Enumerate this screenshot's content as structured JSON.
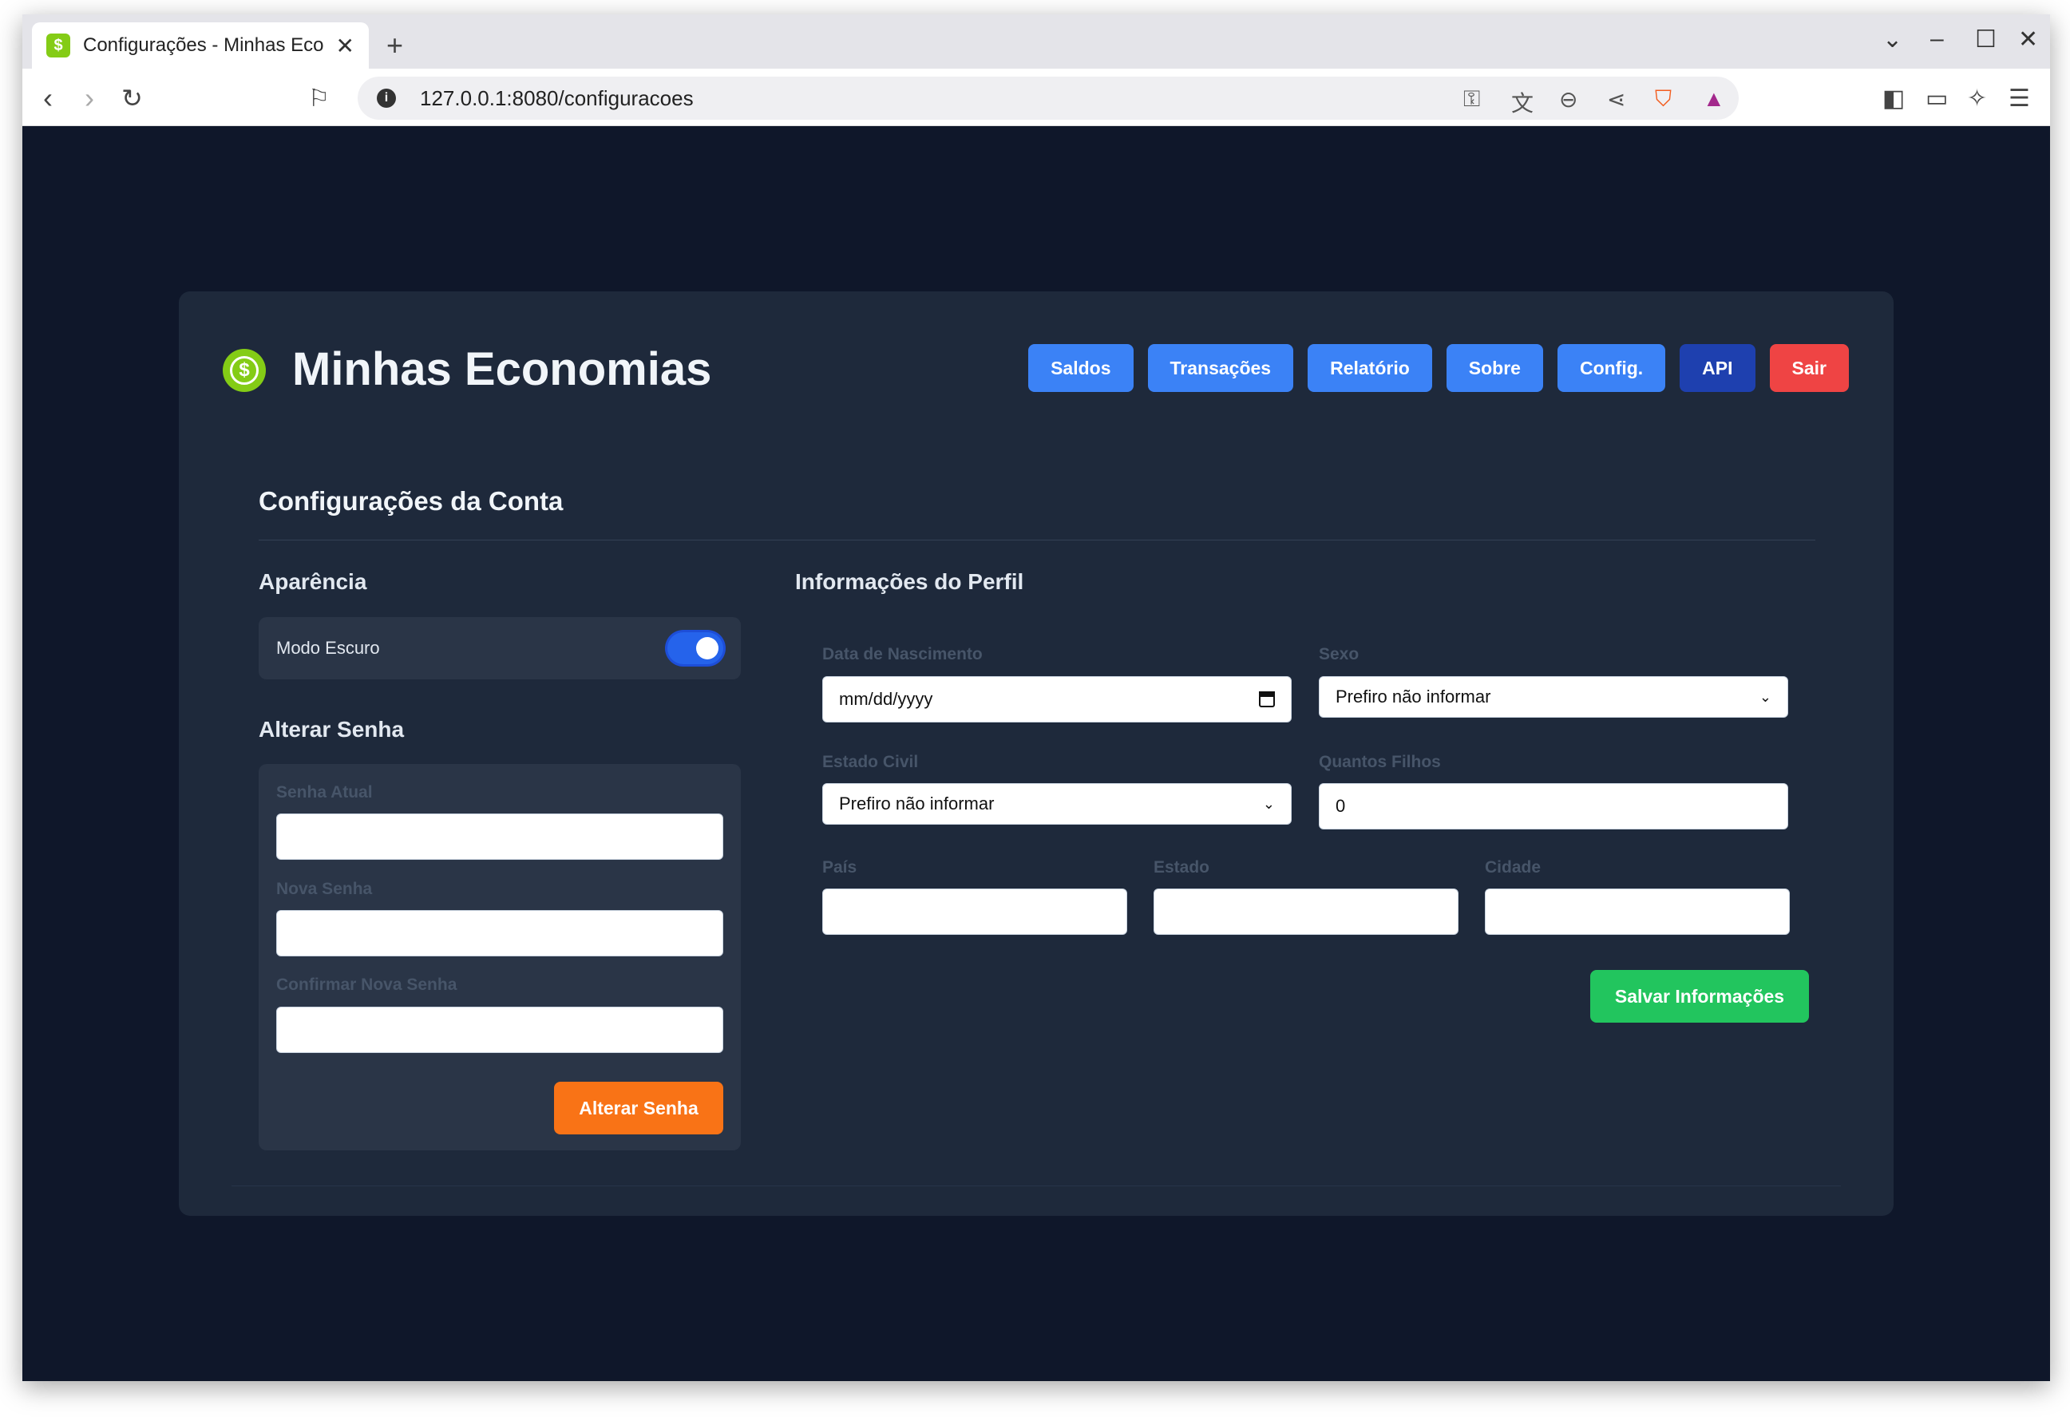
{
  "browser": {
    "tab_title": "Configurações - Minhas Ecor",
    "favicon": "$",
    "url": "127.0.0.1:8080/configuracoes"
  },
  "app": {
    "brand_title": "Minhas Economias",
    "brand_icon": "$",
    "nav": [
      {
        "label": "Saldos"
      },
      {
        "label": "Transações"
      },
      {
        "label": "Relatório"
      },
      {
        "label": "Sobre"
      },
      {
        "label": "Config."
      },
      {
        "label": "API"
      },
      {
        "label": "Sair"
      }
    ]
  },
  "settings": {
    "title": "Configurações da Conta",
    "appearance": {
      "title": "Aparência",
      "dark_mode_label": "Modo Escuro",
      "dark_mode_on": true
    },
    "password": {
      "title": "Alterar Senha",
      "current_label": "Senha Atual",
      "new_label": "Nova Senha",
      "confirm_label": "Confirmar Nova Senha",
      "submit": "Alterar Senha"
    },
    "profile": {
      "title": "Informações do Perfil",
      "birth_label": "Data de Nascimento",
      "birth_value": "mm/dd/yyyy",
      "sex_label": "Sexo",
      "sex_value": "Prefiro não informar",
      "civil_label": "Estado Civil",
      "civil_value": "Prefiro não informar",
      "children_label": "Quantos Filhos",
      "children_value": "0",
      "country_label": "País",
      "state_label": "Estado",
      "city_label": "Cidade",
      "submit": "Salvar Informações"
    }
  },
  "colors": {
    "page_bg": "#0f172a",
    "card_bg": "#1e293b",
    "primary": "#3b82f6",
    "api": "#1e40af",
    "danger": "#ef4444",
    "orange": "#f97316",
    "green": "#22c55e",
    "brand": "#84cc16"
  }
}
